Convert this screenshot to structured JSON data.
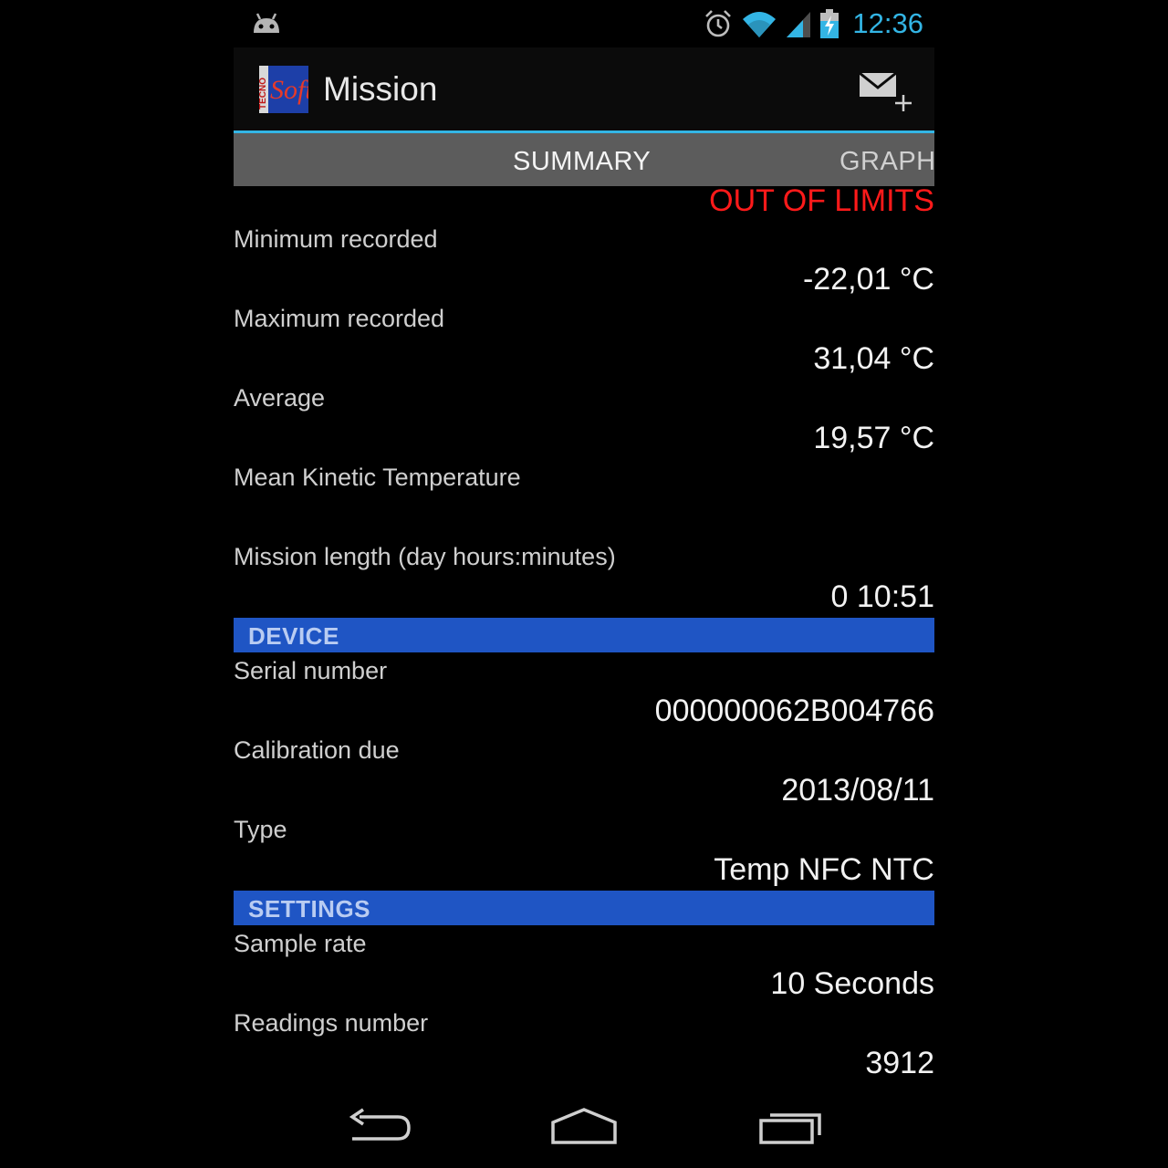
{
  "status_bar": {
    "time": "12:36",
    "icons": [
      "android-icon",
      "alarm-icon",
      "wifi-icon",
      "signal-icon",
      "battery-charging-icon"
    ]
  },
  "action_bar": {
    "logo_icon": "tecnosoft-logo-icon",
    "title": "Mission",
    "action_icon": "new-email-icon"
  },
  "tabs": [
    {
      "label": "SUMMARY",
      "selected": true
    },
    {
      "label": "GRAPH",
      "selected": false
    }
  ],
  "summary": {
    "status": "OUT OF LIMITS",
    "status_color": "#ff1a1a",
    "rows": [
      {
        "label": "Minimum recorded",
        "value": "-22,01 °C"
      },
      {
        "label": "Maximum recorded",
        "value": "31,04 °C"
      },
      {
        "label": "Average",
        "value": "19,57 °C"
      },
      {
        "label": "Mean Kinetic Temperature",
        "value": ""
      },
      {
        "label": "Mission length (day hours:minutes)",
        "value": "0 10:51"
      }
    ]
  },
  "device": {
    "header": "DEVICE",
    "rows": [
      {
        "label": "Serial number",
        "value": "000000062B004766"
      },
      {
        "label": "Calibration due",
        "value": "2013/08/11"
      },
      {
        "label": "Type",
        "value": "Temp NFC NTC"
      }
    ]
  },
  "settings": {
    "header": "SETTINGS",
    "rows": [
      {
        "label": "Sample rate",
        "value": "10 Seconds"
      },
      {
        "label": "Readings number",
        "value": "3912"
      }
    ]
  },
  "nav_bar": {
    "icons": [
      "back-icon",
      "home-icon",
      "recent-apps-icon"
    ]
  },
  "colors": {
    "accent": "#33b5e5",
    "section_header": "#1f55c4",
    "tab_strip": "#5c5c5c"
  }
}
